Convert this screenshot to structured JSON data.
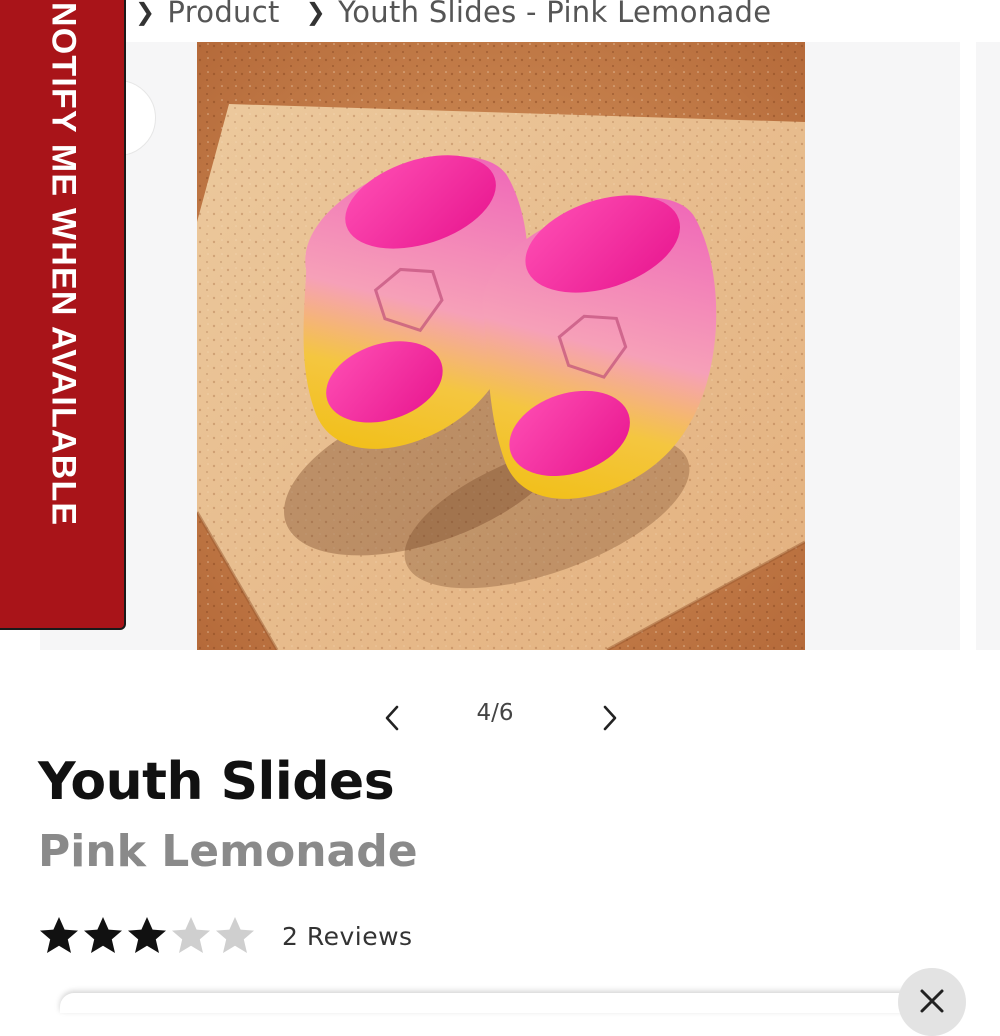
{
  "breadcrumb": {
    "items": [
      "Product",
      "Youth Slides - Pink Lemonade"
    ]
  },
  "notify": {
    "label": "NOTIFY ME WHEN AVAILABLE",
    "color": "#a91419"
  },
  "gallery": {
    "counter": "4/6",
    "current": 4,
    "total": 6
  },
  "product": {
    "title": "Youth Slides",
    "variant": "Pink Lemonade",
    "rating": 3,
    "rating_max": 5,
    "reviews_label": "2 Reviews"
  },
  "icons": {
    "breadcrumb_separator": "chevron-right-icon",
    "prev": "chevron-left-icon",
    "next": "chevron-right-icon",
    "star": "star-icon",
    "close": "close-icon"
  }
}
